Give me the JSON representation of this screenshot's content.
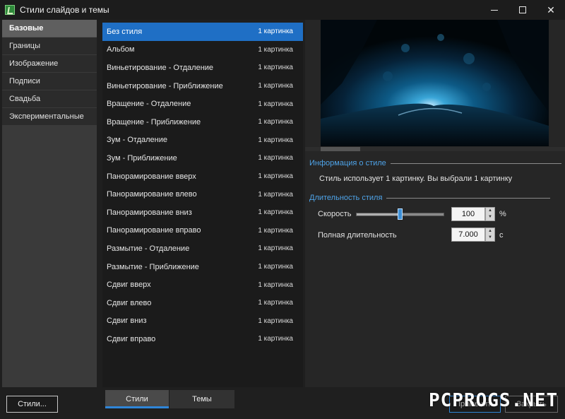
{
  "window": {
    "title": "Стили слайдов и темы",
    "icon": "app-icon",
    "controls": {
      "minimize": "minimize-icon",
      "maximize": "maximize-icon",
      "close": "✕"
    }
  },
  "sidebar": {
    "items": [
      {
        "label": "Базовые",
        "active": true
      },
      {
        "label": "Границы"
      },
      {
        "label": "Изображение"
      },
      {
        "label": "Подписи"
      },
      {
        "label": "Свадьба"
      },
      {
        "label": "Экспериментальные"
      }
    ]
  },
  "styles": {
    "items": [
      {
        "name": "Без стиля",
        "count": "1 картинка",
        "selected": true
      },
      {
        "name": "Альбом",
        "count": "1 картинка"
      },
      {
        "name": "Виньетирование - Отдаление",
        "count": "1 картинка"
      },
      {
        "name": "Виньетирование - Приближение",
        "count": "1 картинка"
      },
      {
        "name": "Вращение - Отдаление",
        "count": "1 картинка"
      },
      {
        "name": "Вращение - Приближение",
        "count": "1 картинка"
      },
      {
        "name": "Зум - Отдаление",
        "count": "1 картинка"
      },
      {
        "name": "Зум - Приближение",
        "count": "1 картинка"
      },
      {
        "name": "Панорамирование вверх",
        "count": "1 картинка"
      },
      {
        "name": "Панорамирование влево",
        "count": "1 картинка"
      },
      {
        "name": "Панорамирование вниз",
        "count": "1 картинка"
      },
      {
        "name": "Панорамирование вправо",
        "count": "1 картинка"
      },
      {
        "name": "Размытие - Отдаление",
        "count": "1 картинка"
      },
      {
        "name": "Размытие - Приближение",
        "count": "1 картинка"
      },
      {
        "name": "Сдвиг вверх",
        "count": "1 картинка"
      },
      {
        "name": "Сдвиг влево",
        "count": "1 картинка"
      },
      {
        "name": "Сдвиг вниз",
        "count": "1 картинка"
      },
      {
        "name": "Сдвиг вправо",
        "count": "1 картинка"
      }
    ]
  },
  "info": {
    "section_title": "Информация о стиле",
    "text": "Стиль использует 1 картинку. Вы выбрали 1 картинку"
  },
  "duration": {
    "section_title": "Длительность стиля",
    "speed_label": "Скорость",
    "speed_value": "100",
    "speed_unit": "%",
    "speed_slider_fraction": 0.5,
    "total_label": "Полная длительность",
    "total_value": "7.000",
    "total_unit": "с"
  },
  "bottom": {
    "styles_button": "Стили...",
    "tabs": [
      {
        "label": "Стили",
        "active": true
      },
      {
        "label": "Темы"
      }
    ],
    "apply_button": "Применить",
    "close_button": "Закрыть",
    "watermark": "PCPROGS.NET"
  },
  "colors": {
    "accent": "#1f6fc5",
    "section_title": "#4ea3e8",
    "background": "#1f1f1f"
  }
}
